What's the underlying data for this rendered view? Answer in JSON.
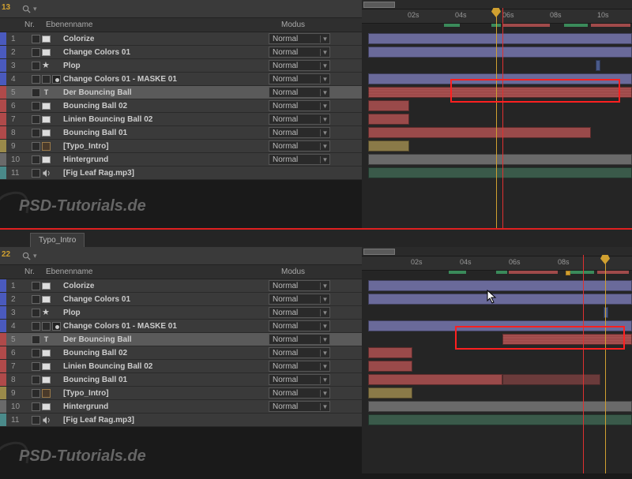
{
  "watermark": "PSD-Tutorials.de",
  "tab_label": "Typo_Intro",
  "top_badge": "13",
  "bottom_badge": "22",
  "headers": {
    "nr": "Nr.",
    "name": "Ebenenname",
    "mode": "Modus"
  },
  "mode_label": "Normal",
  "timeTicksTop": [
    "02s",
    "04s",
    "06s",
    "08s",
    "10s"
  ],
  "timeTicksBot": [
    "02s",
    "04s",
    "06s",
    "08s"
  ],
  "layers": [
    {
      "nr": "1",
      "name": "Colorize",
      "color": "#4a5abe",
      "icon": "solid",
      "mode": true
    },
    {
      "nr": "2",
      "name": "Change Colors 01",
      "color": "#4a5abe",
      "icon": "solid",
      "mode": true
    },
    {
      "nr": "3",
      "name": "Plop",
      "color": "#4a5abe",
      "icon": "star",
      "mode": true
    },
    {
      "nr": "4",
      "name": "Change Colors 01 - MASKE 01",
      "color": "#4a5abe",
      "icon": "mask",
      "mode": true
    },
    {
      "nr": "5",
      "name": "Der Bouncing Ball",
      "color": "#b04a4a",
      "icon": "text",
      "mode": true,
      "selected": true
    },
    {
      "nr": "6",
      "name": "Bouncing Ball 02",
      "color": "#b04a4a",
      "icon": "solid",
      "mode": true
    },
    {
      "nr": "7",
      "name": "Linien Bouncing Ball 02",
      "color": "#b04a4a",
      "icon": "solid",
      "mode": true
    },
    {
      "nr": "8",
      "name": "Bouncing Ball 01",
      "color": "#b04a4a",
      "icon": "solid",
      "mode": true
    },
    {
      "nr": "9",
      "name": "[Typo_Intro]",
      "color": "#9a8a4a",
      "icon": "comp",
      "mode": true
    },
    {
      "nr": "10",
      "name": "Hintergrund",
      "color": "#6a6a6a",
      "icon": "solid",
      "mode": true
    },
    {
      "nr": "11",
      "name": "[Fig Leaf Rag.mp3]",
      "color": "#4a8a8a",
      "icon": "audio",
      "mode": false
    }
  ]
}
